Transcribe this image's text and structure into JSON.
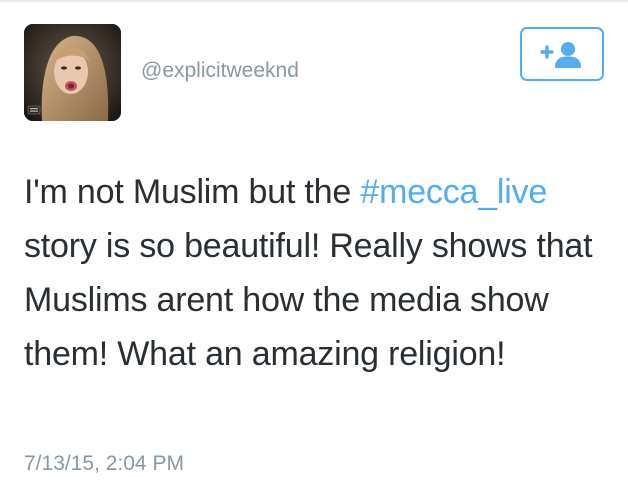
{
  "tweet": {
    "handle": "@explicitweeknd",
    "text_before": "I'm not Muslim but the ",
    "hashtag": "#mecca_live",
    "text_after": " story is so beautiful! Really shows that Muslims arent how the media show them! What an amazing religion!",
    "timestamp": "7/13/15, 2:04 PM"
  },
  "icons": {
    "follow_button_icon": "add-user-icon",
    "avatar": "profile-photo"
  },
  "colors": {
    "accent": "#55acee",
    "text": "#292f33",
    "muted": "#8899a6",
    "background": "#ffffff"
  }
}
